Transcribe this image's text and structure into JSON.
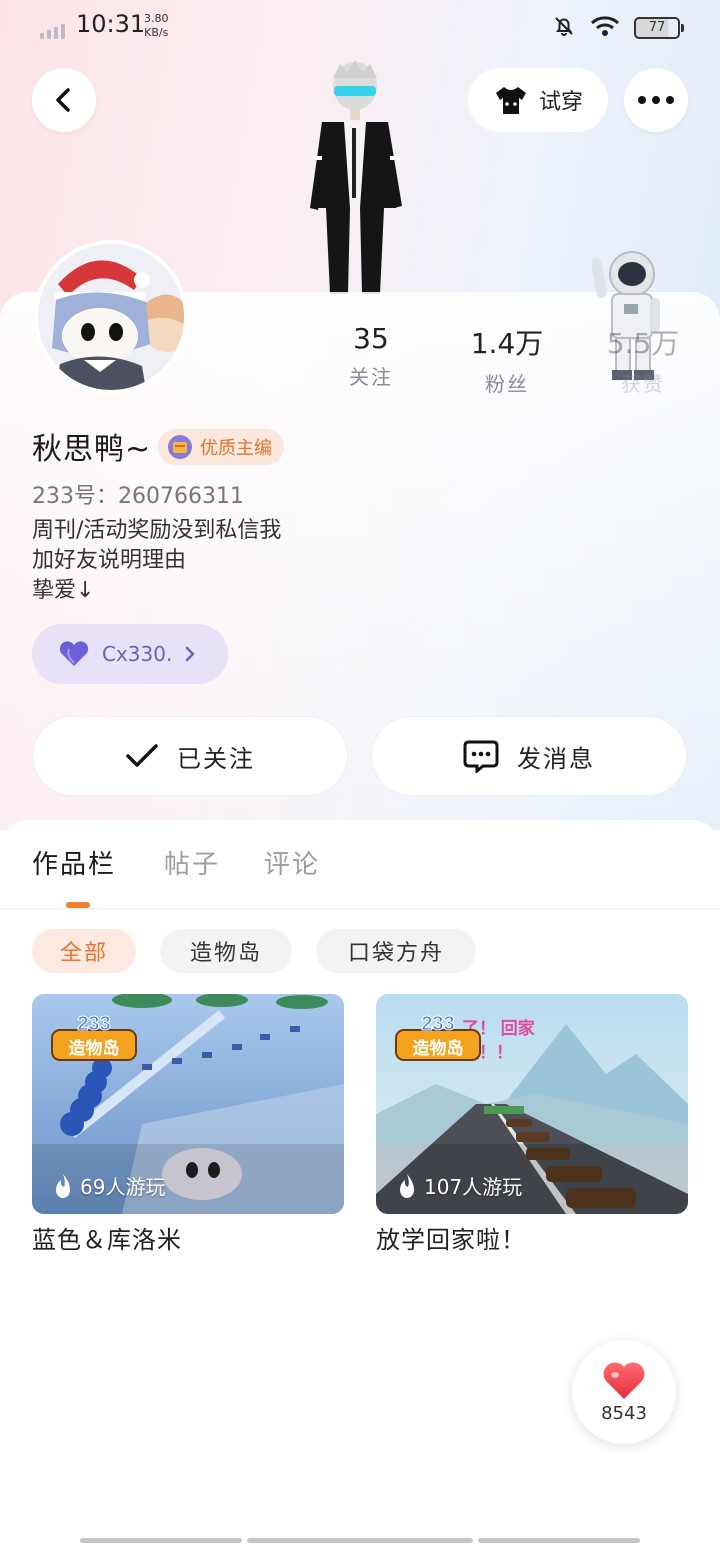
{
  "status_bar": {
    "time": "10:31",
    "speed_value": "3.80",
    "speed_unit": "KB/s",
    "battery": "77"
  },
  "header": {
    "try_on_label": "试穿"
  },
  "profile": {
    "stats": [
      {
        "value": "35",
        "label": "关注"
      },
      {
        "value": "1.4万",
        "label": "粉丝"
      },
      {
        "value": "5.5万",
        "label": "获赞"
      }
    ],
    "username": "秋思鸭~",
    "badge": "优质主编",
    "uid": "233号：260766311",
    "bio": [
      "周刊/活动奖励没到私信我",
      "加好友说明理由",
      "挚爱↓"
    ],
    "fan_chip": "Cx330.",
    "follow_label": "已关注",
    "message_label": "发消息"
  },
  "tabs": [
    {
      "label": "作品栏"
    },
    {
      "label": "帖子"
    },
    {
      "label": "评论"
    }
  ],
  "filters": [
    {
      "label": "全部"
    },
    {
      "label": "造物岛"
    },
    {
      "label": "口袋方舟"
    }
  ],
  "works": [
    {
      "title": "蓝色＆库洛米",
      "plays": "69人游玩",
      "logo_text": "233 造物岛"
    },
    {
      "title": "放学回家啦！",
      "plays": "107人游玩",
      "logo_text": "233 造物岛",
      "overlay_text": "了！ 回家 啦！！"
    }
  ],
  "like_fab": {
    "count": "8543"
  },
  "colors": {
    "accent": "#f0802c",
    "chip_active_bg": "#fde9e0",
    "fan_chip_bg": "#e8e2f8",
    "heart": "#f0454f"
  },
  "icons": [
    "back-icon",
    "tshirt-icon",
    "more-icon",
    "badge-icon",
    "heart-icon",
    "chevron-right-icon",
    "check-icon",
    "chat-icon",
    "flame-icon"
  ]
}
